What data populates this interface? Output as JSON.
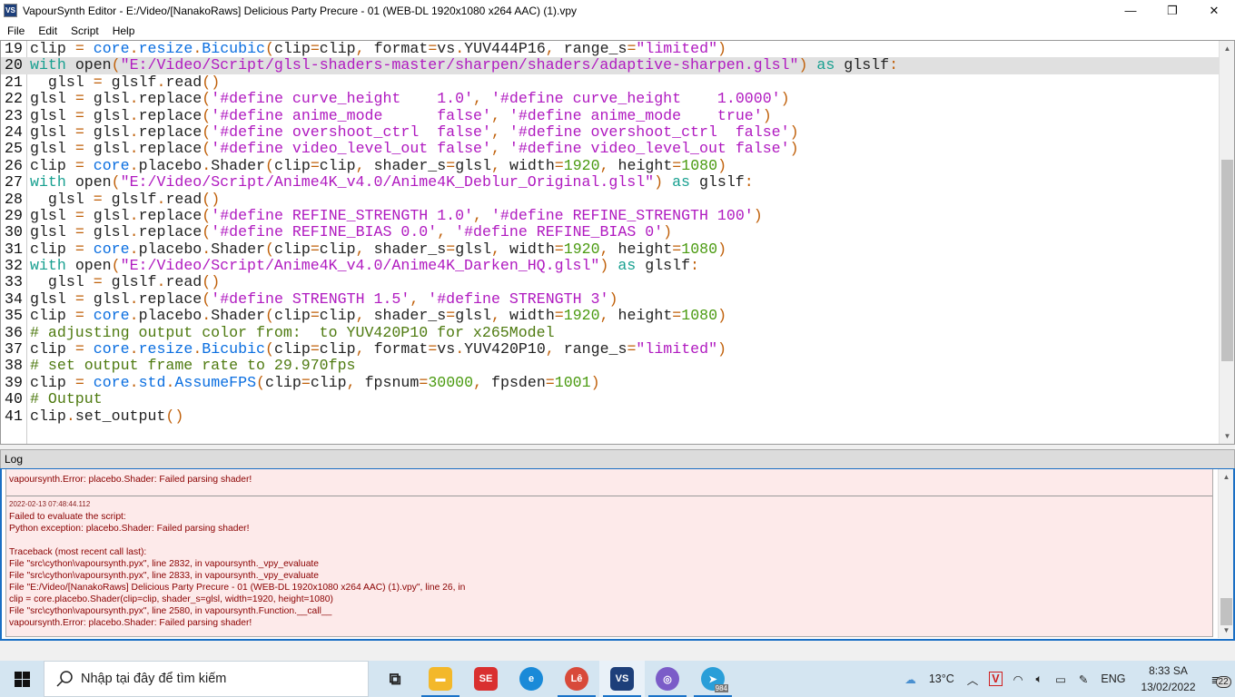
{
  "window": {
    "title": "VapourSynth Editor - E:/Video/[NanakoRaws] Delicious Party Precure - 01 (WEB-DL 1920x1080 x264 AAC) (1).vpy",
    "icon_label": "VS",
    "minimize": "—",
    "maximize": "❐",
    "close": "✕"
  },
  "menu": [
    "File",
    "Edit",
    "Script",
    "Help"
  ],
  "editor": {
    "current_line": 20,
    "lines": [
      {
        "n": "19",
        "text": "clip = core.resize.Bicubic(clip=clip, format=vs.YUV444P16, range_s=\"limited\")"
      },
      {
        "n": "20",
        "text": "with open(\"E:/Video/Script/glsl-shaders-master/sharpen/shaders/adaptive-sharpen.glsl\") as glslf:"
      },
      {
        "n": "21",
        "text": "  glsl = glslf.read()"
      },
      {
        "n": "22",
        "text": "glsl = glsl.replace('#define curve_height    1.0', '#define curve_height    1.0000')"
      },
      {
        "n": "23",
        "text": "glsl = glsl.replace('#define anime_mode      false', '#define anime_mode    true')"
      },
      {
        "n": "24",
        "text": "glsl = glsl.replace('#define overshoot_ctrl  false', '#define overshoot_ctrl  false')"
      },
      {
        "n": "25",
        "text": "glsl = glsl.replace('#define video_level_out false', '#define video_level_out false')"
      },
      {
        "n": "26",
        "text": "clip = core.placebo.Shader(clip=clip, shader_s=glsl, width=1920, height=1080)"
      },
      {
        "n": "27",
        "text": "with open(\"E:/Video/Script/Anime4K_v4.0/Anime4K_Deblur_Original.glsl\") as glslf:"
      },
      {
        "n": "28",
        "text": "  glsl = glslf.read()"
      },
      {
        "n": "29",
        "text": "glsl = glsl.replace('#define REFINE_STRENGTH 1.0', '#define REFINE_STRENGTH 100')"
      },
      {
        "n": "30",
        "text": "glsl = glsl.replace('#define REFINE_BIAS 0.0', '#define REFINE_BIAS 0')"
      },
      {
        "n": "31",
        "text": "clip = core.placebo.Shader(clip=clip, shader_s=glsl, width=1920, height=1080)"
      },
      {
        "n": "32",
        "text": "with open(\"E:/Video/Script/Anime4K_v4.0/Anime4K_Darken_HQ.glsl\") as glslf:"
      },
      {
        "n": "33",
        "text": "  glsl = glslf.read()"
      },
      {
        "n": "34",
        "text": "glsl = glsl.replace('#define STRENGTH 1.5', '#define STRENGTH 3')"
      },
      {
        "n": "35",
        "text": "clip = core.placebo.Shader(clip=clip, shader_s=glsl, width=1920, height=1080)"
      },
      {
        "n": "36",
        "text": "# adjusting output color from:  to YUV420P10 for x265Model"
      },
      {
        "n": "37",
        "text": "clip = core.resize.Bicubic(clip=clip, format=vs.YUV420P10, range_s=\"limited\")"
      },
      {
        "n": "38",
        "text": "# set output frame rate to 29.970fps"
      },
      {
        "n": "39",
        "text": "clip = core.std.AssumeFPS(clip=clip, fpsnum=30000, fpsden=1001)"
      },
      {
        "n": "40",
        "text": "# Output"
      },
      {
        "n": "41",
        "text": "clip.set_output()"
      }
    ],
    "scroll_position": 0.6
  },
  "log": {
    "title": "Log",
    "prev_entry_tail": "vapoursynth.Error: placebo.Shader: Failed parsing shader!",
    "timestamp": "2022-02-13 07:48:44.112",
    "lines": [
      "Failed to evaluate the script:",
      "Python exception: placebo.Shader: Failed parsing shader!",
      "",
      "Traceback (most recent call last):",
      "File \"src\\cython\\vapoursynth.pyx\", line 2832, in vapoursynth._vpy_evaluate",
      "File \"src\\cython\\vapoursynth.pyx\", line 2833, in vapoursynth._vpy_evaluate",
      "File \"E:/Video/[NanakoRaws] Delicious Party Precure - 01 (WEB-DL 1920x1080 x264 AAC) (1).vpy\", line 26, in",
      "clip = core.placebo.Shader(clip=clip, shader_s=glsl, width=1920, height=1080)",
      "File \"src\\cython\\vapoursynth.pyx\", line 2580, in vapoursynth.Function.__call__",
      "vapoursynth.Error: placebo.Shader: Failed parsing shader!"
    ]
  },
  "taskbar": {
    "search_placeholder": "Nhập tại đây để tìm kiếm",
    "apps": [
      {
        "name": "task-view",
        "label": "⧉",
        "color": "transparent"
      },
      {
        "name": "file-explorer",
        "label": "▬",
        "color": "#f3b82a"
      },
      {
        "name": "subtitle-edit",
        "label": "SE",
        "color": "#d93030"
      },
      {
        "name": "edge",
        "label": "e",
        "color": "#1a8ad8"
      },
      {
        "name": "chrome",
        "label": "Lê",
        "color": "#d84a3a"
      },
      {
        "name": "vapoursynth-editor",
        "label": "VS",
        "color": "#1d3f7a"
      },
      {
        "name": "bittorrent",
        "label": "◎",
        "color": "#7b5cc8"
      },
      {
        "name": "telegram",
        "label": "➤",
        "color": "#2a9ed8",
        "badge": "984"
      }
    ],
    "weather": "13°C",
    "language": "ENG",
    "time": "8:33 SA",
    "date": "13/02/2022",
    "notifications": "22"
  }
}
